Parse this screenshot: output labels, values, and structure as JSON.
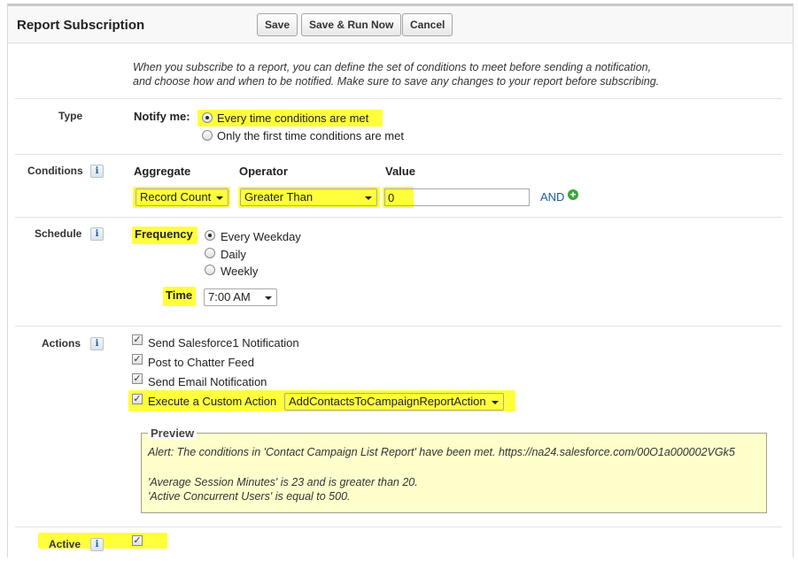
{
  "header": {
    "title": "Report Subscription",
    "save_label": "Save",
    "save_run_label": "Save & Run Now",
    "cancel_label": "Cancel"
  },
  "intro": {
    "line1": "When you subscribe to a report, you can define the set of conditions to meet before sending a notification,",
    "line2": "and choose how and when to be notified. Make sure to save any changes to your report before subscribing."
  },
  "type": {
    "label": "Type",
    "notify_label": "Notify me:",
    "options": [
      {
        "label": "Every time conditions are met",
        "selected": true
      },
      {
        "label": "Only the first time conditions are met",
        "selected": false
      }
    ]
  },
  "conditions": {
    "label": "Conditions",
    "info_icon": "i",
    "aggregate_header": "Aggregate",
    "operator_header": "Operator",
    "value_header": "Value",
    "aggregate_value": "Record Count",
    "operator_value": "Greater Than",
    "value": "0",
    "and_label": "AND",
    "add_icon": "+"
  },
  "schedule": {
    "label": "Schedule",
    "info_icon": "i",
    "frequency_label": "Frequency",
    "frequency_options": [
      {
        "label": "Every Weekday",
        "selected": true
      },
      {
        "label": "Daily",
        "selected": false
      },
      {
        "label": "Weekly",
        "selected": false
      }
    ],
    "time_label": "Time",
    "time_value": "7:00 AM"
  },
  "actions": {
    "label": "Actions",
    "info_icon": "i",
    "items": [
      {
        "label": "Send Salesforce1 Notification",
        "checked": true
      },
      {
        "label": "Post to Chatter Feed",
        "checked": true
      },
      {
        "label": "Send Email Notification",
        "checked": true
      },
      {
        "label": "Execute a Custom Action",
        "checked": true
      }
    ],
    "custom_action_value": "AddContactsToCampaignReportAction",
    "checkmark": "✓"
  },
  "preview": {
    "title": "Preview",
    "line1": "Alert: The conditions in 'Contact Campaign List Report' have been met. https://na24.salesforce.com/00O1a000002VGk5",
    "line2": "'Average Session Minutes' is 23 and is greater than 20.",
    "line3": "'Active Concurrent Users' is equal to 500."
  },
  "active": {
    "label": "Active",
    "info_icon": "i",
    "checked": true
  },
  "colors": {
    "highlight": "#ffff3c",
    "link": "#1b5aa8",
    "preview_bg": "#ffffcc"
  }
}
